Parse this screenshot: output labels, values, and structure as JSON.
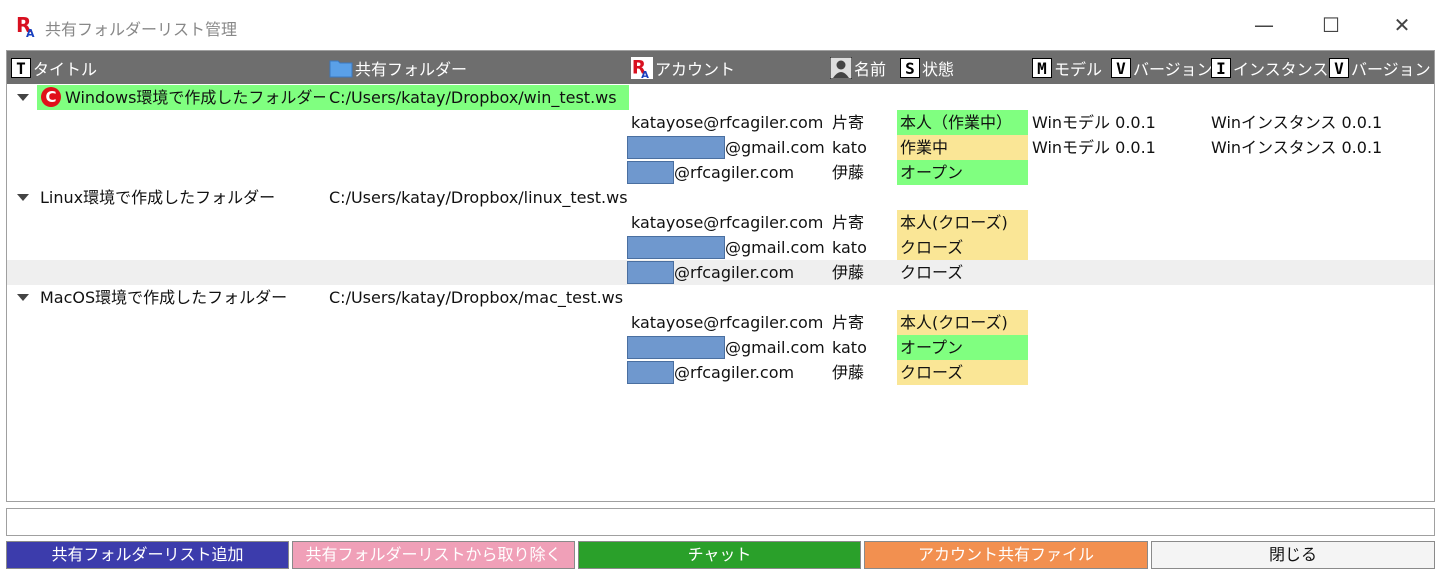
{
  "window": {
    "title": "共有フォルダーリスト管理",
    "minimize": "—",
    "maximize": "☐",
    "close": "✕"
  },
  "columns": {
    "title": {
      "icon": "T",
      "label": "タイトル"
    },
    "folder": {
      "label": "共有フォルダー"
    },
    "account": {
      "label": "アカウント"
    },
    "name": {
      "label": "名前"
    },
    "status": {
      "icon": "S",
      "label": "状態"
    },
    "model": {
      "icon": "M",
      "label": "モデル"
    },
    "model_version": {
      "icon": "V",
      "label": "バージョン"
    },
    "instance": {
      "icon": "I",
      "label": "インスタンス"
    },
    "instance_version": {
      "icon": "V",
      "label": "バージョン"
    }
  },
  "folders": [
    {
      "title": "Windows環境で作成したフォルダー",
      "path": "C:/Users/katay/Dropbox/win_test.ws",
      "accounts": [
        {
          "email": "katayose@rfcagiler.com",
          "name": "片寄",
          "status": "本人（作業中）",
          "model": "Winモデル 0.0.1",
          "instance": "Winインスタンス 0.0.1"
        },
        {
          "email": "@gmail.com",
          "name": "kato",
          "status": "作業中",
          "model": "Winモデル 0.0.1",
          "instance": "Winインスタンス 0.0.1"
        },
        {
          "email": "@rfcagiler.com",
          "name": "伊藤",
          "status": "オープン",
          "model": "",
          "instance": ""
        }
      ]
    },
    {
      "title": "Linux環境で作成したフォルダー",
      "path": "C:/Users/katay/Dropbox/linux_test.ws",
      "accounts": [
        {
          "email": "katayose@rfcagiler.com",
          "name": "片寄",
          "status": "本人(クローズ)"
        },
        {
          "email": "@gmail.com",
          "name": "kato",
          "status": "クローズ"
        },
        {
          "email": "@rfcagiler.com",
          "name": "伊藤",
          "status": "クローズ"
        }
      ]
    },
    {
      "title": "MacOS環境で作成したフォルダー",
      "path": "C:/Users/katay/Dropbox/mac_test.ws",
      "accounts": [
        {
          "email": "katayose@rfcagiler.com",
          "name": "片寄",
          "status": "本人(クローズ)"
        },
        {
          "email": "@gmail.com",
          "name": "kato",
          "status": "オープン"
        },
        {
          "email": "@rfcagiler.com",
          "name": "伊藤",
          "status": "クローズ"
        }
      ]
    }
  ],
  "buttons": {
    "add": "共有フォルダーリスト追加",
    "remove": "共有フォルダーリストから取り除く",
    "chat": "チャット",
    "account_files": "アカウント共有ファイル",
    "close": "閉じる"
  },
  "colors": {
    "header": "#6e6e6e",
    "green": "#80ff80",
    "yellow": "#fae696",
    "btn_add": "#3c3cac",
    "btn_remove": "#f0a0b8",
    "btn_chat": "#2aa02a",
    "btn_account": "#f29050"
  }
}
